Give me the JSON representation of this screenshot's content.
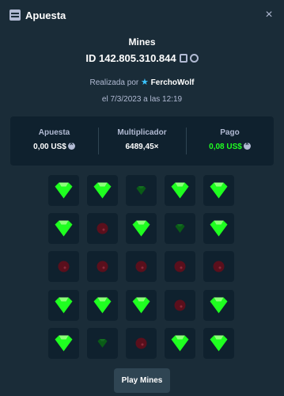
{
  "header": {
    "title": "Apuesta",
    "icon": "bet-slip-icon",
    "close_icon": "close-icon",
    "close_glyph": "×"
  },
  "bet": {
    "game": "Mines",
    "id": "ID 142.805.310.844",
    "placed_by_prefix": "Realizada por",
    "user": "FerchoWolf",
    "date": "el 7/3/2023 a las 12:19"
  },
  "stats": {
    "bet_label": "Apuesta",
    "bet_value": "0,00 US$",
    "multiplier_label": "Multiplicador",
    "multiplier_value": "6489,45×",
    "payout_label": "Pago",
    "payout_value": "0,08 US$"
  },
  "board": {
    "rows": [
      [
        "gem",
        "gem",
        "gem-dim",
        "gem",
        "gem"
      ],
      [
        "gem",
        "mine-dim",
        "gem",
        "gem-dim",
        "gem"
      ],
      [
        "mine-dim",
        "mine-dim",
        "mine-dim",
        "mine-dim",
        "mine-dim"
      ],
      [
        "gem",
        "gem",
        "gem",
        "mine-dim",
        "gem"
      ],
      [
        "gem",
        "gem-dim",
        "mine-dim",
        "gem",
        "gem"
      ]
    ]
  },
  "colors": {
    "gem": "#1fff20",
    "gem_dim": "#0a5c17",
    "mine": "#5a0f1c",
    "tile": "#0f212e",
    "bg": "#1a2c38"
  },
  "action": {
    "play_label": "Play Mines"
  }
}
